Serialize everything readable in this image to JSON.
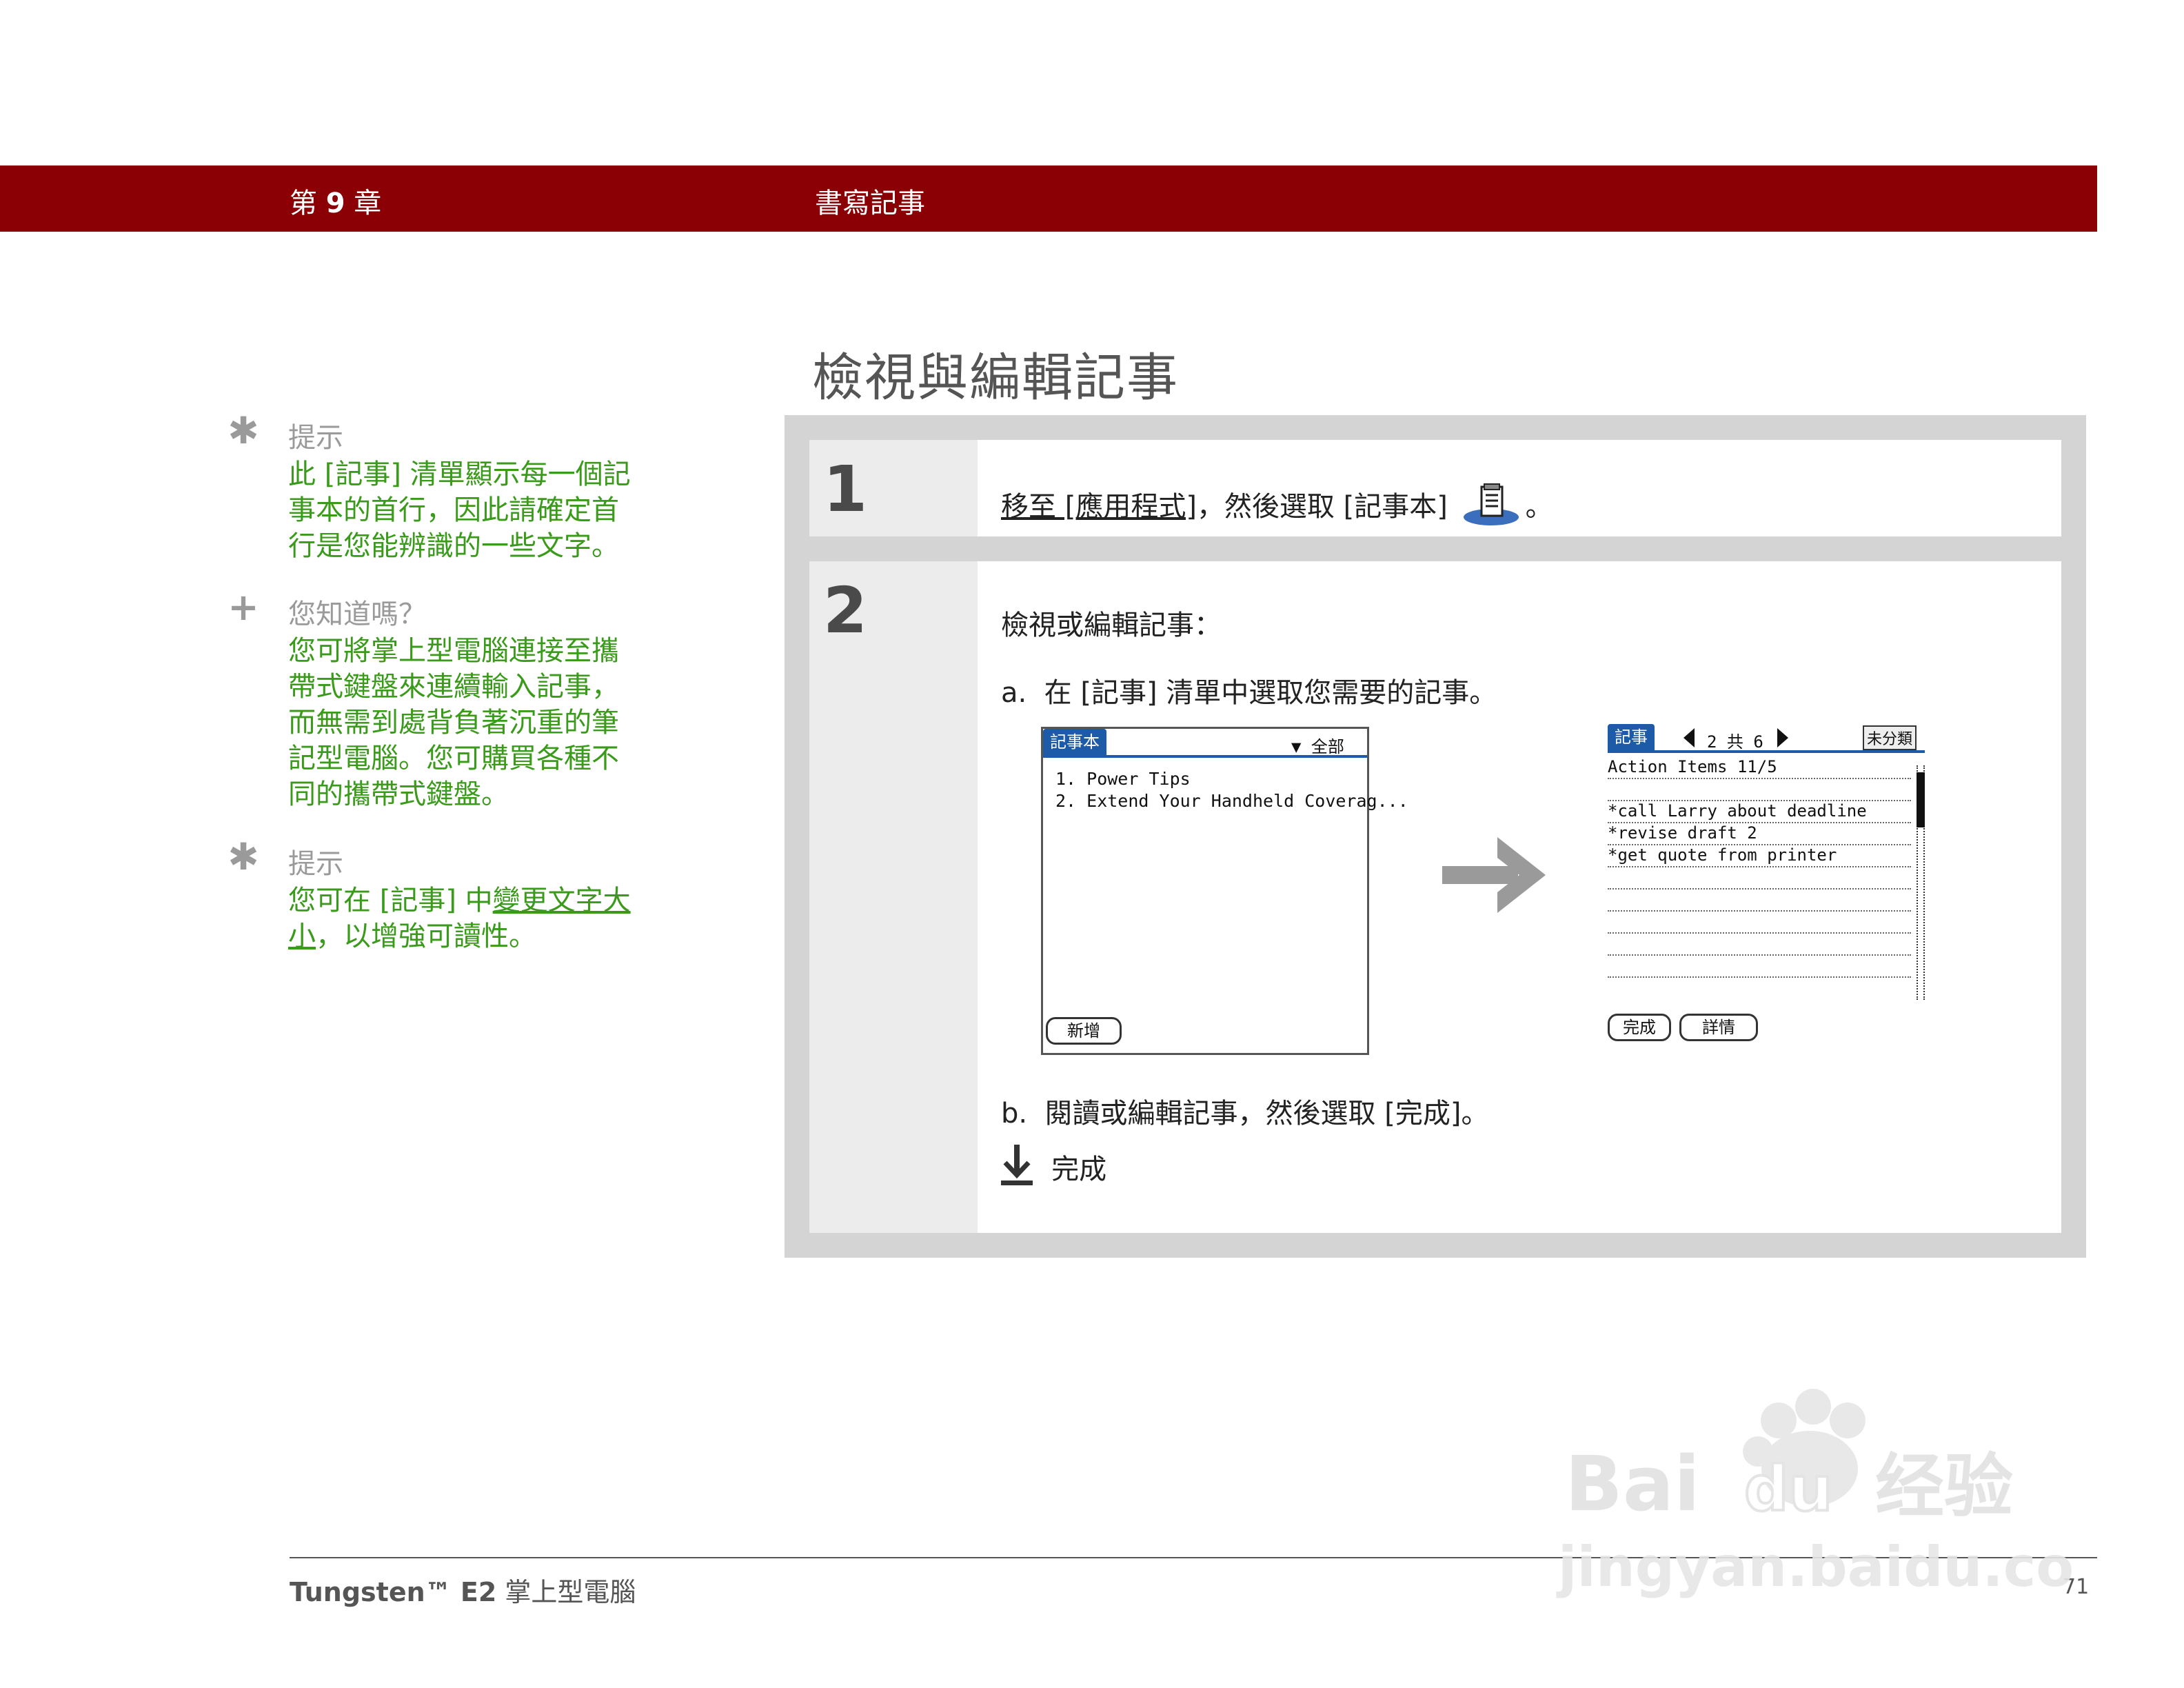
{
  "header": {
    "chapter_prefix": "第",
    "chapter_number": "9",
    "chapter_suffix": "章",
    "section": "書寫記事"
  },
  "page_title": "檢視與編輯記事",
  "sidebar": {
    "tips": [
      {
        "icon": "asterisk-icon",
        "title": "提示",
        "body": "此 [記事] 清單顯示每一個記事本的首行，因此請確定首行是您能辨識的一些文字。"
      },
      {
        "icon": "plus-icon",
        "title": "您知道嗎？",
        "body": "您可將掌上型電腦連接至攜帶式鍵盤來連續輸入記事，而無需到處背負著沉重的筆記型電腦。您可購買各種不同的攜帶式鍵盤。"
      },
      {
        "icon": "asterisk-icon",
        "title": "提示",
        "body_prefix": "您可在 [記事] 中",
        "body_link": "變更文字大小",
        "body_suffix": "，以增強可讀性。"
      }
    ]
  },
  "steps": [
    {
      "number": "1",
      "link_text": "移至 [應用程式]",
      "text": "，然後選取 [記事本]",
      "end": "。"
    },
    {
      "number": "2",
      "intro": "檢視或編輯記事：",
      "sub_a_label": "a.",
      "sub_a_text": "在 [記事] 清單中選取您需要的記事。",
      "sub_b_label": "b.",
      "sub_b_text": "閱讀或編輯記事，然後選取 [完成]。",
      "done_label": "完成"
    }
  ],
  "screen_list": {
    "tab": "記事本",
    "category": "▼ 全部",
    "items": [
      "1. Power Tips",
      "2. Extend Your Handheld Coverag..."
    ],
    "new_button": "新增"
  },
  "screen_note": {
    "tab": "記事",
    "pager": "2 共 6",
    "category": "未分類",
    "lines": [
      "Action Items 11/5",
      "",
      "*call Larry about deadline",
      "*revise draft 2",
      "*get quote from printer"
    ],
    "done_button": "完成",
    "details_button": "詳情"
  },
  "footer": {
    "product_bold": "Tungsten™ E2",
    "product_rest": " 掌上型電腦",
    "page_number": "71"
  },
  "colors": {
    "header_bar": "#8a0004",
    "tip_text": "#3a9a1a",
    "palm_blue": "#1d5aa8"
  }
}
